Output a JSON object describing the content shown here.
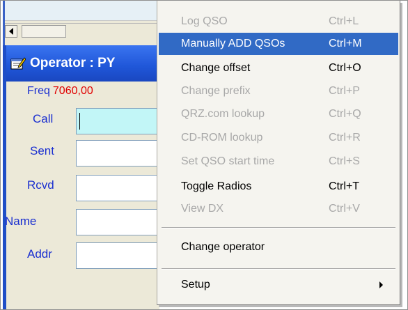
{
  "operator_window": {
    "title": "Operator : PY",
    "freq_label": "Freq",
    "freq_value": "7060,00",
    "fields": [
      {
        "label": "Call",
        "value": ""
      },
      {
        "label": "Sent",
        "value": ""
      },
      {
        "label": "Rcvd",
        "value": ""
      },
      {
        "label": "Name",
        "value": ""
      },
      {
        "label": "Addr",
        "value": ""
      }
    ]
  },
  "context_menu": {
    "items": [
      {
        "label": "Log QSO",
        "accel": "Ctrl+L",
        "state": "disabled"
      },
      {
        "label": "Manually ADD QSOs",
        "accel": "Ctrl+M",
        "state": "selected"
      },
      {
        "label": "Change offset",
        "accel": "Ctrl+O",
        "state": "enabled"
      },
      {
        "label": "Change prefix",
        "accel": "Ctrl+P",
        "state": "disabled"
      },
      {
        "label": "QRZ.com lookup",
        "accel": "Ctrl+Q",
        "state": "disabled"
      },
      {
        "label": "CD-ROM lookup",
        "accel": "Ctrl+R",
        "state": "disabled"
      },
      {
        "label": "Set QSO start time",
        "accel": "Ctrl+S",
        "state": "disabled"
      },
      {
        "label": "Toggle Radios",
        "accel": "Ctrl+T",
        "state": "enabled"
      },
      {
        "label": "View DX",
        "accel": "Ctrl+V",
        "state": "disabled"
      },
      {
        "label": "Change operator",
        "accel": "",
        "state": "enabled"
      },
      {
        "label": "Setup",
        "accel": "",
        "state": "enabled",
        "submenu": true
      }
    ]
  },
  "colors": {
    "menu_highlight": "#316ac5",
    "title_bar": "#1f56d8",
    "label_blue": "#1a2fd0",
    "freq_red": "#e00000",
    "call_field_bg": "#c2f6f7"
  }
}
